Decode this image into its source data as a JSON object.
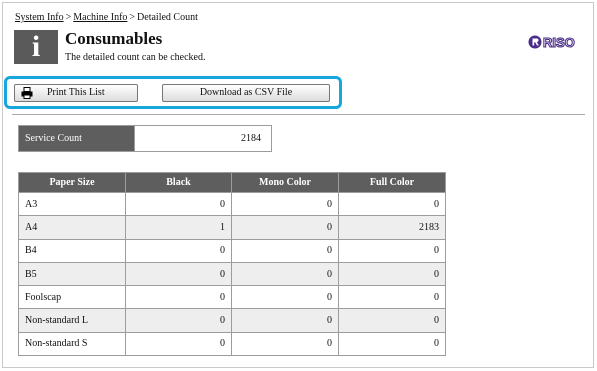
{
  "breadcrumb": {
    "items": [
      "System Info",
      "Machine Info"
    ],
    "current": "Detailed Count",
    "separator": ">"
  },
  "header": {
    "icon": "info-icon",
    "icon_glyph": "i",
    "title": "Consumables",
    "subtitle": "The detailed count can be checked.",
    "logo_text": "RISO"
  },
  "toolbar": {
    "print_label": "Print This List",
    "print_icon": "printer-icon",
    "csv_label": "Download as CSV File",
    "highlight_color": "#19a6dd"
  },
  "service_count": {
    "label": "Service Count",
    "value": "2184"
  },
  "table": {
    "headers": [
      "Paper Size",
      "Black",
      "Mono Color",
      "Full Color"
    ],
    "rows": [
      [
        "A3",
        "0",
        "0",
        "0"
      ],
      [
        "A4",
        "1",
        "0",
        "2183"
      ],
      [
        "B4",
        "0",
        "0",
        "0"
      ],
      [
        "B5",
        "0",
        "0",
        "0"
      ],
      [
        "Foolscap",
        "0",
        "0",
        "0"
      ],
      [
        "Non-standard L",
        "0",
        "0",
        "0"
      ],
      [
        "Non-standard S",
        "0",
        "0",
        "0"
      ]
    ]
  },
  "colors": {
    "header_bg": "#5e5e5e",
    "alt_row_bg": "#eeeeee",
    "logo_color": "#4a2c8a"
  }
}
